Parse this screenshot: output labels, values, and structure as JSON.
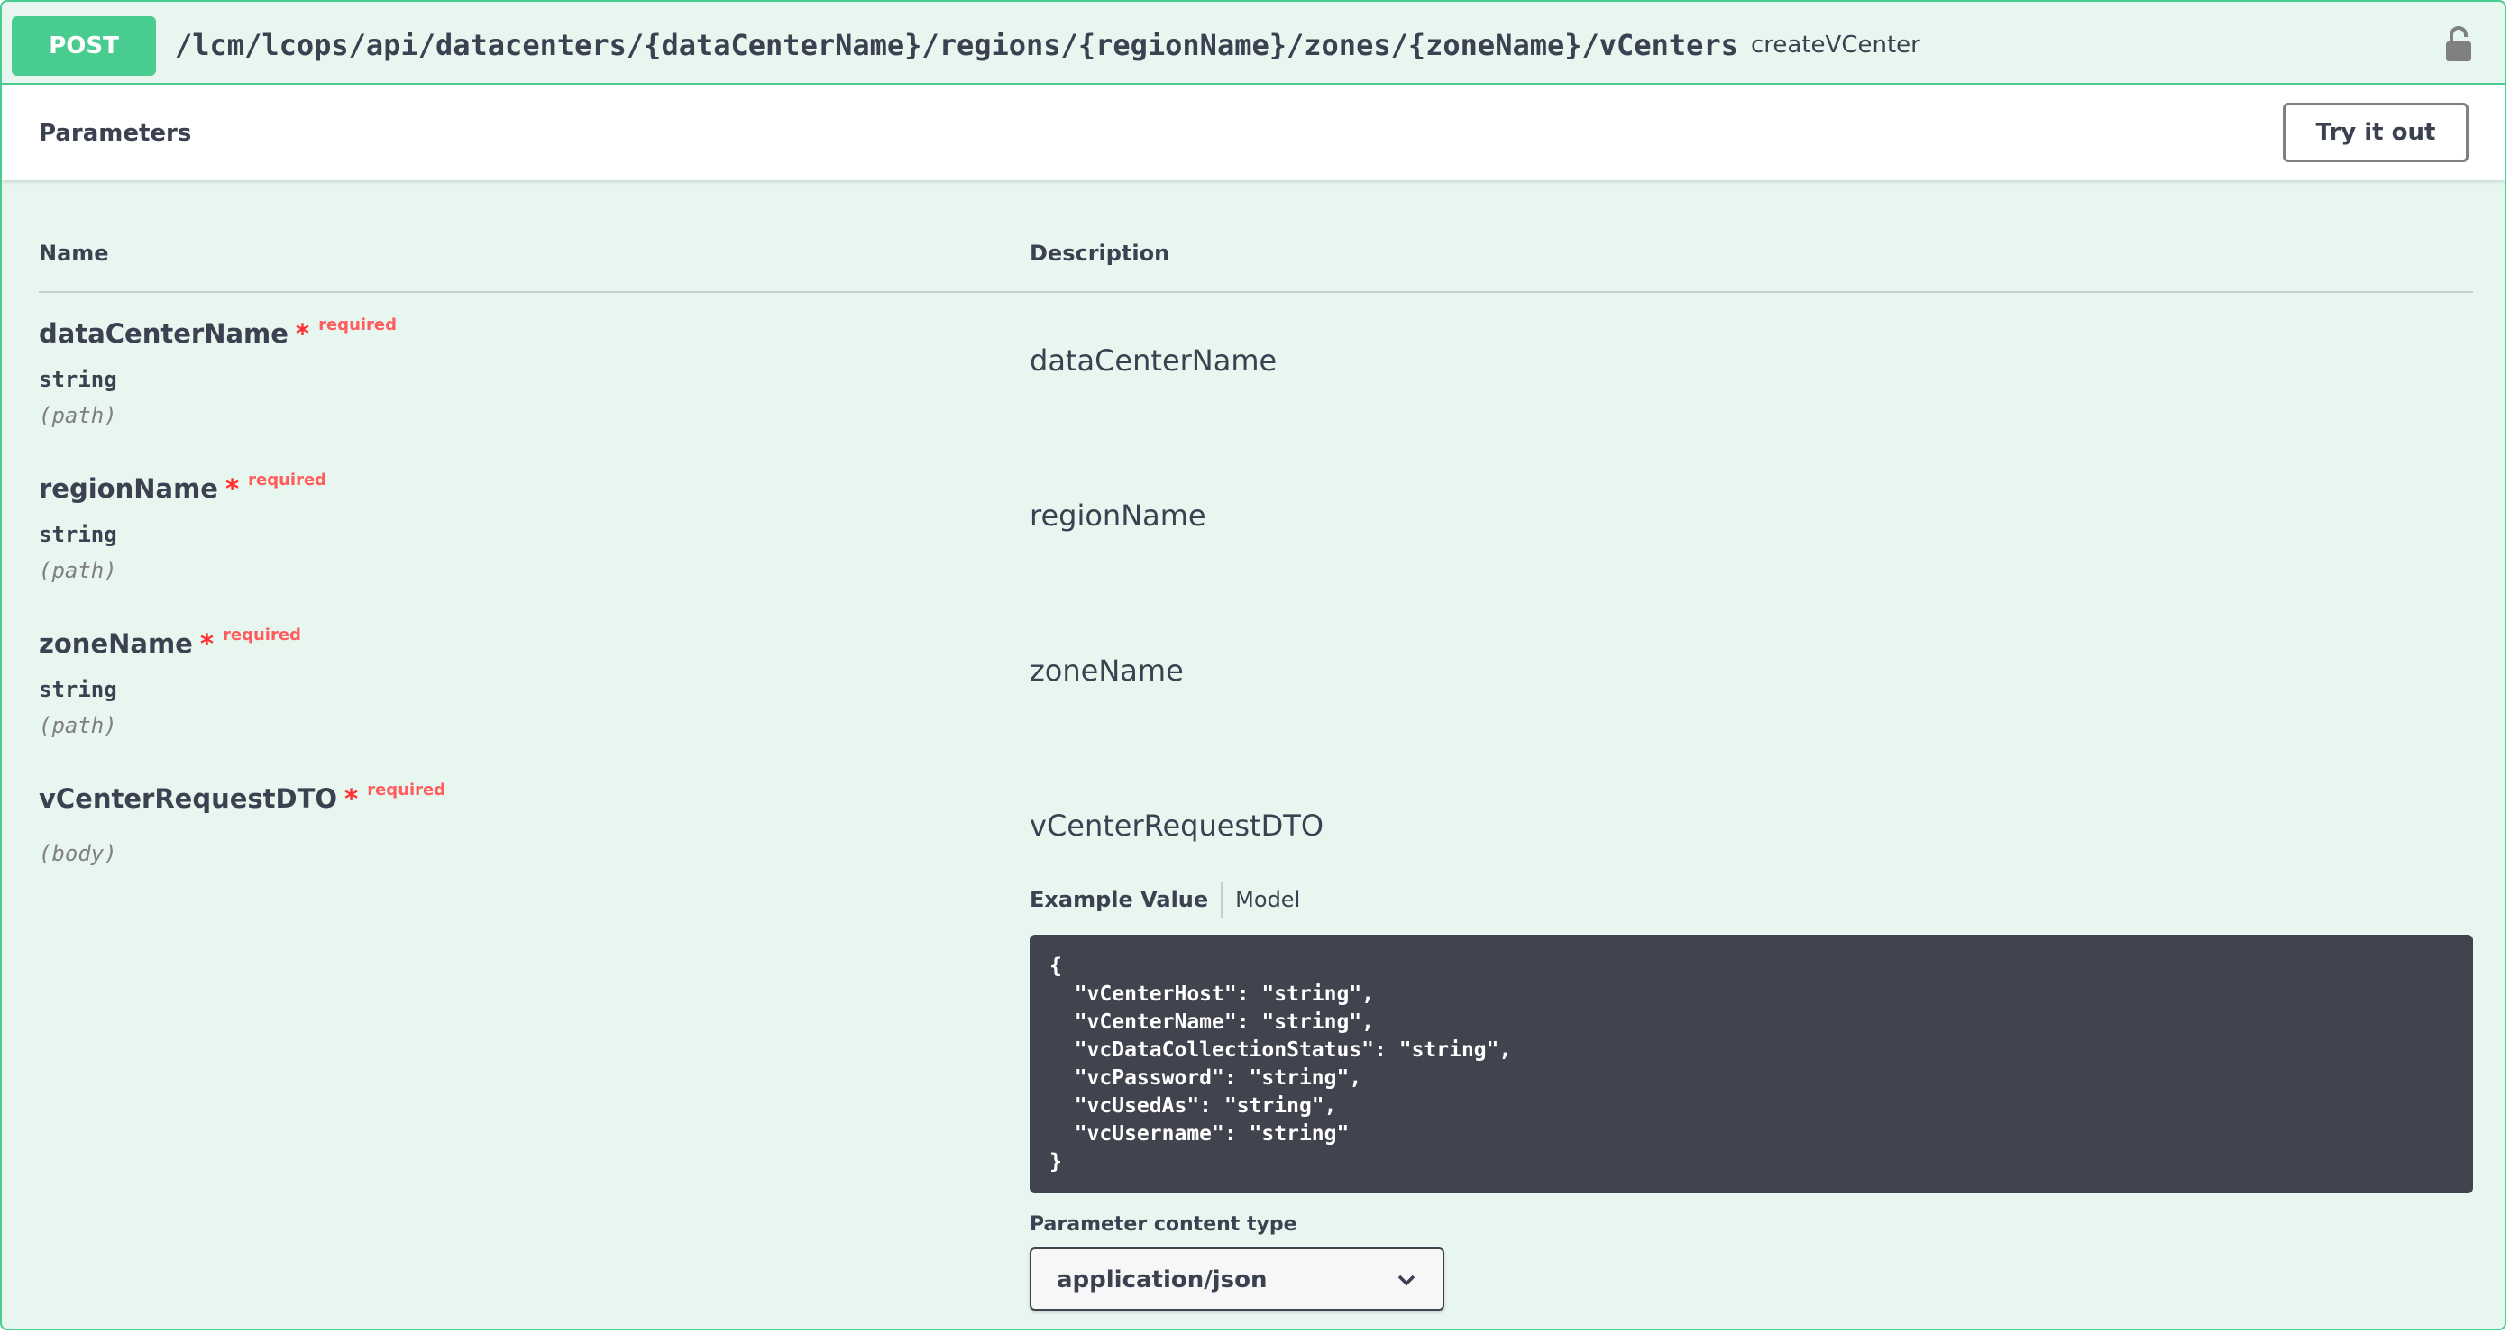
{
  "operation": {
    "method": "POST",
    "path": "/lcm/lcops/api/datacenters/{dataCenterName}/regions/{regionName}/zones/{zoneName}/vCenters",
    "operation_id": "createVCenter",
    "lock_icon": "lock-icon",
    "colors": {
      "accent": "#49cc90",
      "background": "#e8f6f0",
      "required": "#ff2f2f"
    }
  },
  "parameters": {
    "title": "Parameters",
    "try_it_out_label": "Try it out",
    "columns": {
      "name": "Name",
      "description": "Description"
    },
    "required_label": "required",
    "required_star": "*",
    "items": [
      {
        "name": "dataCenterName",
        "type": "string",
        "in": "(path)",
        "description": "dataCenterName"
      },
      {
        "name": "regionName",
        "type": "string",
        "in": "(path)",
        "description": "regionName"
      },
      {
        "name": "zoneName",
        "type": "string",
        "in": "(path)",
        "description": "zoneName"
      },
      {
        "name": "vCenterRequestDTO",
        "in": "(body)",
        "description": "vCenterRequestDTO"
      }
    ]
  },
  "body": {
    "tabs": [
      "Example Value",
      "Model"
    ],
    "example_value": "{\n  \"vCenterHost\": \"string\",\n  \"vCenterName\": \"string\",\n  \"vcDataCollectionStatus\": \"string\",\n  \"vcPassword\": \"string\",\n  \"vcUsedAs\": \"string\",\n  \"vcUsername\": \"string\"\n}",
    "content_type_label": "Parameter content type",
    "content_type_value": "application/json"
  }
}
